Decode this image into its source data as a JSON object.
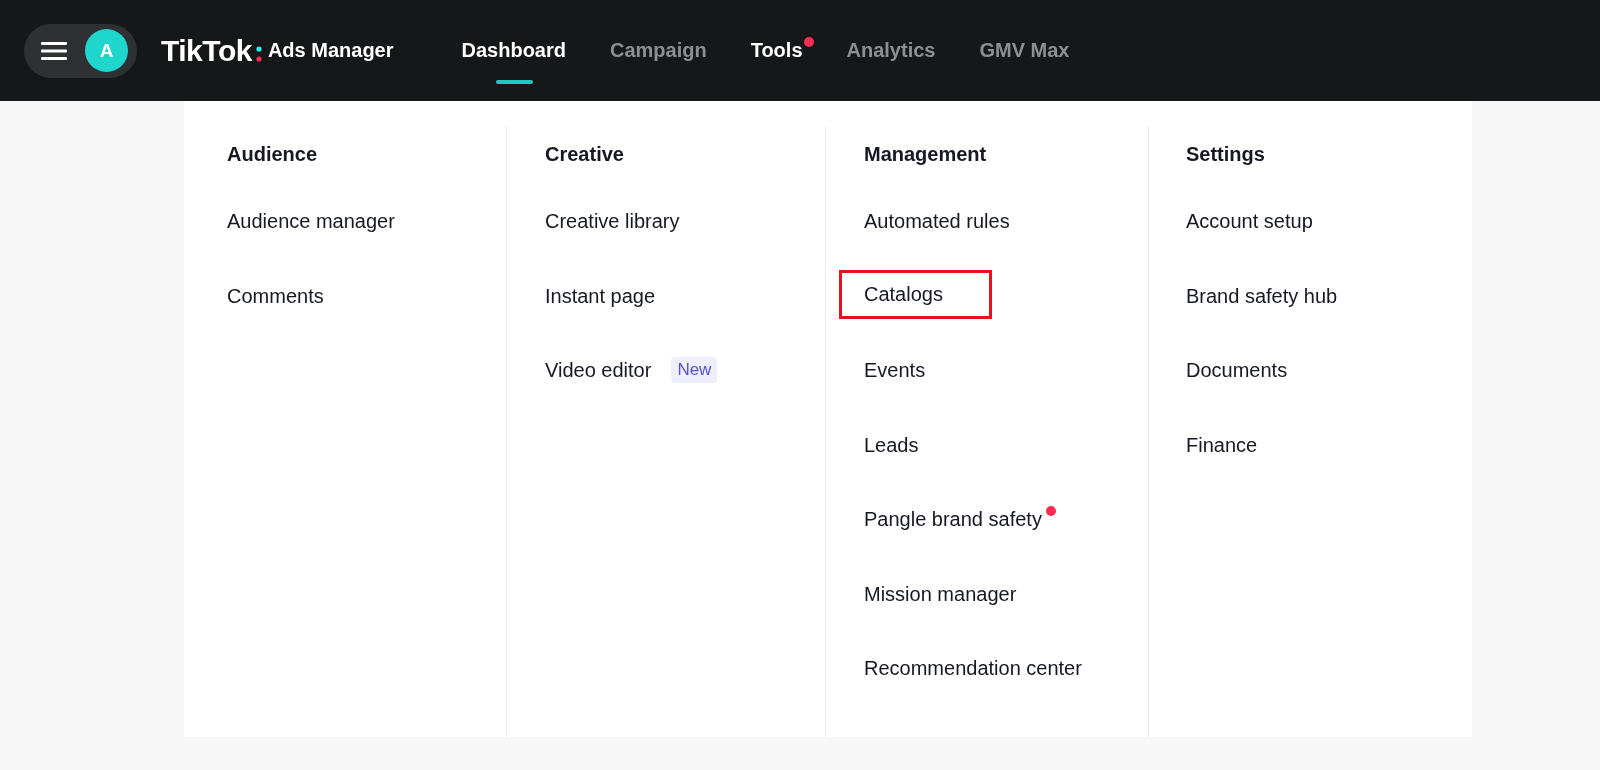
{
  "topbar": {
    "avatar": "A",
    "logo": "TikTok",
    "logo_suffix": "Ads Manager",
    "nav": [
      {
        "label": "Dashboard",
        "selected": true,
        "expanded": false,
        "dot": false
      },
      {
        "label": "Campaign",
        "selected": false,
        "expanded": false,
        "dot": false
      },
      {
        "label": "Tools",
        "selected": false,
        "expanded": true,
        "dot": true
      },
      {
        "label": "Analytics",
        "selected": false,
        "expanded": false,
        "dot": false
      },
      {
        "label": "GMV Max",
        "selected": false,
        "expanded": false,
        "dot": false
      }
    ]
  },
  "menu": {
    "columns": [
      {
        "heading": "Audience",
        "items": [
          {
            "label": "Audience manager",
            "highlighted": false,
            "dot": false
          },
          {
            "label": "Comments",
            "highlighted": false,
            "dot": false
          }
        ]
      },
      {
        "heading": "Creative",
        "items": [
          {
            "label": "Creative library",
            "highlighted": false,
            "dot": false
          },
          {
            "label": "Instant page",
            "highlighted": false,
            "dot": false
          },
          {
            "label": "Video editor",
            "badge": "New",
            "highlighted": false,
            "dot": false
          }
        ]
      },
      {
        "heading": "Management",
        "items": [
          {
            "label": "Automated rules",
            "highlighted": false,
            "dot": false
          },
          {
            "label": "Catalogs",
            "highlighted": true,
            "dot": false
          },
          {
            "label": "Events",
            "highlighted": false,
            "dot": false
          },
          {
            "label": "Leads",
            "highlighted": false,
            "dot": false
          },
          {
            "label": "Pangle brand safety",
            "highlighted": false,
            "dot": true
          },
          {
            "label": "Mission manager",
            "highlighted": false,
            "dot": false
          },
          {
            "label": "Recommendation center",
            "highlighted": false,
            "dot": false
          }
        ]
      },
      {
        "heading": "Settings",
        "items": [
          {
            "label": "Account setup",
            "highlighted": false,
            "dot": false
          },
          {
            "label": "Brand safety hub",
            "highlighted": false,
            "dot": false
          },
          {
            "label": "Documents",
            "highlighted": false,
            "dot": false
          },
          {
            "label": "Finance",
            "highlighted": false,
            "dot": false
          }
        ]
      }
    ]
  }
}
